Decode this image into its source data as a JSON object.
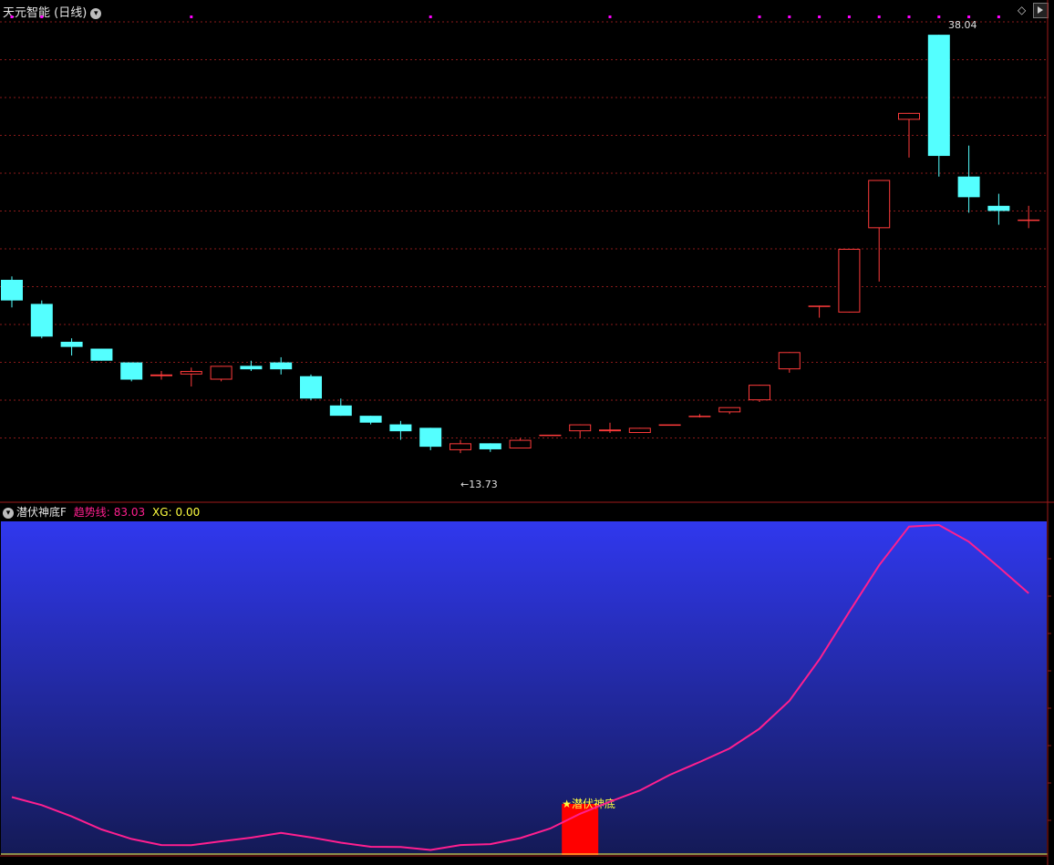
{
  "header": {
    "title": "天元智能 (日线)"
  },
  "indicator": {
    "name": "潜伏神底F",
    "trend_label": "趋势线:",
    "trend_value": "83.03",
    "xg_label": "XG:",
    "xg_value": "0.00",
    "signal_text": "★潜伏神底"
  },
  "annotations": {
    "high_label": "38.04",
    "low_label": "←13.73"
  },
  "colors": {
    "up": "#ff3b3b",
    "down": "#54ffff",
    "grid": "#8a1a1a",
    "trend": "#ff1f8f",
    "signal": "#ff0000",
    "marker": "#ff00ff",
    "indicator_bg_top": "#3038ee",
    "indicator_bg_bottom": "#141a56"
  },
  "chart_data": [
    {
      "type": "candlestick",
      "ylim": [
        12.2,
        39.0
      ],
      "candles": [
        {
          "o": 23.8,
          "h": 24.0,
          "l": 22.2,
          "c": 22.6
        },
        {
          "o": 22.4,
          "h": 22.6,
          "l": 20.4,
          "c": 20.5
        },
        {
          "o": 20.2,
          "h": 20.4,
          "l": 19.4,
          "c": 19.9
        },
        {
          "o": 19.8,
          "h": 19.8,
          "l": 19.1,
          "c": 19.1
        },
        {
          "o": 19.0,
          "h": 19.0,
          "l": 17.9,
          "c": 18.0
        },
        {
          "o": 18.2,
          "h": 18.5,
          "l": 18.0,
          "c": 18.3
        },
        {
          "o": 18.3,
          "h": 18.7,
          "l": 17.6,
          "c": 18.5
        },
        {
          "o": 18.0,
          "h": 18.8,
          "l": 17.9,
          "c": 18.8
        },
        {
          "o": 18.8,
          "h": 19.1,
          "l": 18.5,
          "c": 18.6
        },
        {
          "o": 19.0,
          "h": 19.3,
          "l": 18.3,
          "c": 18.6
        },
        {
          "o": 18.2,
          "h": 18.3,
          "l": 16.8,
          "c": 16.9
        },
        {
          "o": 16.5,
          "h": 16.9,
          "l": 15.9,
          "c": 15.9
        },
        {
          "o": 15.9,
          "h": 15.9,
          "l": 15.4,
          "c": 15.5
        },
        {
          "o": 15.4,
          "h": 15.6,
          "l": 14.5,
          "c": 15.0
        },
        {
          "o": 15.2,
          "h": 15.2,
          "l": 13.9,
          "c": 14.1
        },
        {
          "o": 13.9,
          "h": 14.5,
          "l": 13.73,
          "c": 14.3
        },
        {
          "o": 14.3,
          "h": 14.3,
          "l": 13.8,
          "c": 13.95
        },
        {
          "o": 14.0,
          "h": 14.6,
          "l": 14.0,
          "c": 14.5
        },
        {
          "o": 14.8,
          "h": 14.8,
          "l": 14.8,
          "c": 14.8
        },
        {
          "o": 15.0,
          "h": 15.4,
          "l": 14.6,
          "c": 15.4
        },
        {
          "o": 15.0,
          "h": 15.5,
          "l": 14.9,
          "c": 15.1
        },
        {
          "o": 14.9,
          "h": 15.2,
          "l": 14.9,
          "c": 15.2
        },
        {
          "o": 15.4,
          "h": 15.4,
          "l": 15.4,
          "c": 15.4
        },
        {
          "o": 15.9,
          "h": 16.0,
          "l": 15.8,
          "c": 15.9
        },
        {
          "o": 16.1,
          "h": 16.2,
          "l": 16.0,
          "c": 16.4
        },
        {
          "o": 16.8,
          "h": 17.7,
          "l": 16.7,
          "c": 17.7
        },
        {
          "o": 18.6,
          "h": 19.6,
          "l": 18.4,
          "c": 19.6
        },
        {
          "o": 22.3,
          "h": 22.3,
          "l": 21.6,
          "c": 22.3
        },
        {
          "o": 21.9,
          "h": 25.6,
          "l": 21.9,
          "c": 25.6
        },
        {
          "o": 26.8,
          "h": 29.6,
          "l": 23.7,
          "c": 29.6
        },
        {
          "o": 33.1,
          "h": 33.5,
          "l": 30.9,
          "c": 33.5
        },
        {
          "o": 38.04,
          "h": 38.04,
          "l": 29.8,
          "c": 31.0
        },
        {
          "o": 29.8,
          "h": 31.6,
          "l": 27.7,
          "c": 28.6
        },
        {
          "o": 28.1,
          "h": 28.8,
          "l": 27.0,
          "c": 27.8
        },
        {
          "o": 27.3,
          "h": 28.1,
          "l": 26.8,
          "c": 27.3
        }
      ]
    },
    {
      "type": "line",
      "series": [
        {
          "name": "趋势线",
          "values": [
            21.7,
            18.0,
            12.8,
            6.8,
            2.4,
            -0.4,
            -0.5,
            1.3,
            3.0,
            5.2,
            3.1,
            0.7,
            -1.2,
            -1.3,
            -2.7,
            -0.4,
            0.0,
            2.8,
            7.2,
            14.0,
            19.6,
            24.8,
            32.0,
            37.9,
            44.2,
            53.3,
            66.2,
            85.2,
            107.2,
            128.7,
            146.6,
            147.3,
            139.6,
            127.9,
            115.8
          ]
        }
      ],
      "ylim": [
        -5,
        149
      ],
      "bar_signal": {
        "index": 19,
        "value": 18.6
      }
    }
  ]
}
